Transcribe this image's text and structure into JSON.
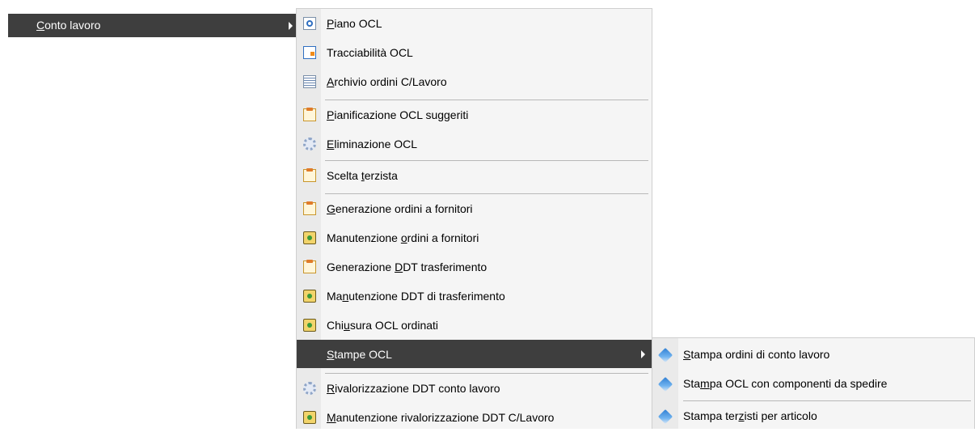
{
  "parent": {
    "label_before": "",
    "label_u": "C",
    "label_after": "onto lavoro"
  },
  "menu": {
    "items": [
      {
        "icon": "search-document-icon",
        "pre": "",
        "u": "P",
        "post": "iano OCL"
      },
      {
        "icon": "grid-chart-icon",
        "pre": "Tracciabilità OCL",
        "u": "",
        "post": ""
      },
      {
        "icon": "list-document-icon",
        "pre": "",
        "u": "A",
        "post": "rchivio ordini C/Lavoro"
      },
      {
        "icon": "clipboard-icon",
        "pre": "",
        "u": "P",
        "post": "ianificazione OCL suggeriti"
      },
      {
        "icon": "gear-icon",
        "pre": "",
        "u": "E",
        "post": "liminazione OCL"
      },
      {
        "icon": "clipboard-icon",
        "pre": "Scelta ",
        "u": "t",
        "post": "erzista"
      },
      {
        "icon": "clipboard-icon",
        "pre": "",
        "u": "G",
        "post": "enerazione ordini a fornitori"
      },
      {
        "icon": "settings-folder-icon",
        "pre": "Manutenzione ",
        "u": "o",
        "post": "rdini a fornitori"
      },
      {
        "icon": "clipboard-icon",
        "pre": "Generazione ",
        "u": "D",
        "post": "DT trasferimento"
      },
      {
        "icon": "settings-folder-icon",
        "pre": "Ma",
        "u": "n",
        "post": "utenzione DDT di trasferimento"
      },
      {
        "icon": "settings-folder-icon",
        "pre": "Chi",
        "u": "u",
        "post": "sura OCL ordinati"
      },
      {
        "icon": "",
        "pre": "",
        "u": "S",
        "post": "tampe OCL"
      },
      {
        "icon": "gear-icon",
        "pre": "",
        "u": "R",
        "post": "ivalorizzazione DDT conto lavoro"
      },
      {
        "icon": "settings-folder-icon",
        "pre": "",
        "u": "M",
        "post": "anutenzione rivalorizzazione DDT C/Lavoro"
      }
    ]
  },
  "submenu": {
    "items": [
      {
        "icon": "print-icon",
        "pre": "",
        "u": "S",
        "post": "tampa ordini di conto lavoro"
      },
      {
        "icon": "print-icon",
        "pre": "Sta",
        "u": "m",
        "post": "pa OCL con componenti da spedire"
      },
      {
        "icon": "print-icon",
        "pre": "Stampa ter",
        "u": "z",
        "post": "isti per articolo"
      }
    ]
  },
  "colors": {
    "highlight": "#3e3e3e",
    "menu_bg": "#f5f5f5",
    "gutter": "#eaeaea"
  }
}
